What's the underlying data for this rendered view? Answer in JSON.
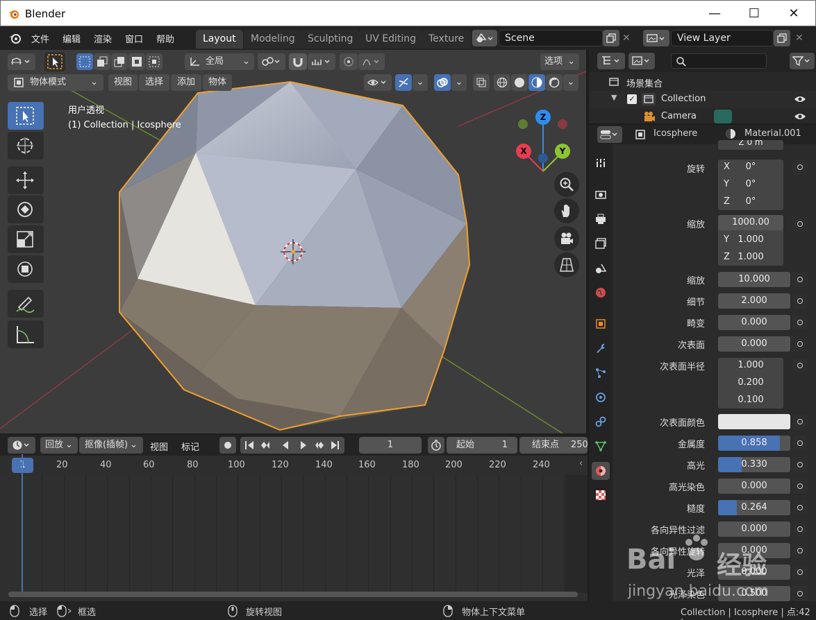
{
  "window": {
    "title": "Blender"
  },
  "menu": [
    "文件",
    "编辑",
    "渲染",
    "窗口",
    "帮助"
  ],
  "workspaces": [
    "Layout",
    "Modeling",
    "Sculpting",
    "UV Editing",
    "Texture"
  ],
  "scene": {
    "name": "Scene"
  },
  "view_layer": {
    "name": "View Layer"
  },
  "viewport_header": {
    "transform_orientation": "全局",
    "options_label": "选项",
    "mode": "物体模式",
    "menus": [
      "视图",
      "选择",
      "添加",
      "物体"
    ]
  },
  "viewport_overlay": {
    "view_name": "用户透视",
    "collection_info": "(1) Collection | Icosphere"
  },
  "gizmo": {
    "z": "Z",
    "x": "X",
    "y": "Y"
  },
  "timeline": {
    "playback": "回放",
    "keying": "抠像(插帧)",
    "view": "视图",
    "marker": "标记",
    "current_frame": "1",
    "start_label": "起始",
    "start_value": "1",
    "end_label": "结束点",
    "end_value": "250",
    "ruler": [
      "1",
      "20",
      "40",
      "60",
      "80",
      "100",
      "120",
      "140",
      "160",
      "180",
      "200",
      "220",
      "240"
    ]
  },
  "outliner": {
    "scene_collection": "场景集合",
    "collection": "Collection",
    "camera": "Camera"
  },
  "properties": {
    "object": "Icosphere",
    "material": "Material.001",
    "partial_top": "Z    0 m",
    "rotation": {
      "label": "旋转",
      "x": "0°",
      "y": "0°",
      "z": "0°"
    },
    "scale_vec": {
      "label": "缩放",
      "x": "1000.00",
      "y": "1.000",
      "z": "1.000"
    },
    "rows": [
      {
        "label": "缩放",
        "value": "10.000"
      },
      {
        "label": "细节",
        "value": "2.000"
      },
      {
        "label": "畸变",
        "value": "0.000"
      },
      {
        "label": "次表面",
        "value": "0.000"
      }
    ],
    "subsurface_radius": {
      "label": "次表面半径",
      "a": "1.000",
      "b": "0.200",
      "c": "0.100"
    },
    "subsurface_color_label": "次表面颜色",
    "metallic": {
      "label": "金属度",
      "value": "0.858",
      "fraction": 0.858
    },
    "specular": {
      "label": "高光",
      "value": "0.330",
      "fraction": 0.33
    },
    "specular_tint": {
      "label": "高光染色",
      "value": "0.000"
    },
    "roughness": {
      "label": "糙度",
      "value": "0.264",
      "fraction": 0.264
    },
    "anisotropic": {
      "label": "各向异性过滤",
      "value": "0.000"
    },
    "anisotropic_rotation": {
      "label": "各向异性旋转",
      "value": "0.000"
    },
    "sheen": {
      "label": "光泽",
      "value": "0.000"
    },
    "sheen_tint": {
      "label": "光泽染色",
      "value": "0.500"
    }
  },
  "status": {
    "select": "选择",
    "box_select": "框选",
    "rotate_view": "旋转视图",
    "context_menu": "物体上下文菜单",
    "info": "Collection | Icosphere | 点:42 |"
  },
  "watermark": {
    "brand": "Bai",
    "brand_cn": "经验",
    "url": "jingyan.baidu.com"
  },
  "colors": {
    "accent": "#4772b3",
    "selection_outline": "#f0a030",
    "axis_x": "#e83c52",
    "axis_y": "#8cc531",
    "axis_z": "#2e8ef0"
  }
}
